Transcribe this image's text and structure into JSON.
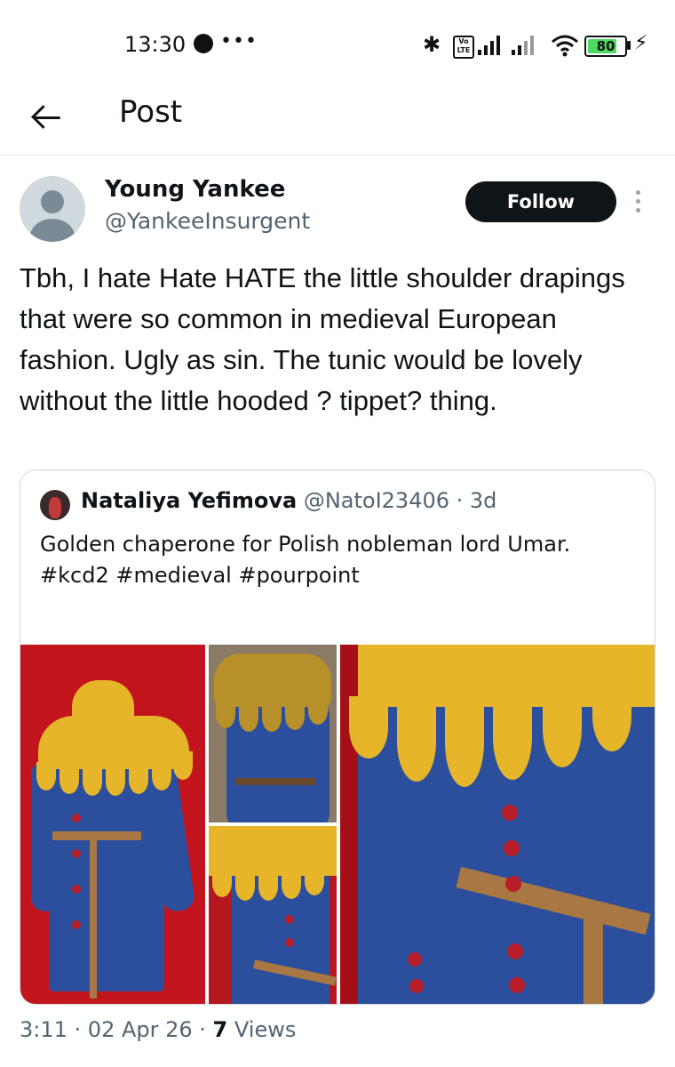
{
  "status_bar": {
    "time": "13:30",
    "dots": "•••",
    "volte": "Vo LTE",
    "battery": "80",
    "colors": {
      "battery_fill": "#4cd964"
    }
  },
  "header": {
    "back_icon": "arrow-left-icon",
    "title": "Post"
  },
  "author": {
    "name": "Young Yankee",
    "handle": "@YankeeInsurgent",
    "follow_label": "Follow"
  },
  "post": {
    "text": "Tbh, I hate Hate HATE the little shoulder drapings that were so common in medieval European fashion. Ugly as sin. The tunic would be lovely without the little hooded ? tippet? thing."
  },
  "quoted": {
    "name": "Nataliya Yefimova",
    "handle": "@NatoI23406",
    "separator": " · ",
    "age": "3d",
    "text": "Golden chaperone for Polish nobleman lord Umar.\n#kcd2 #medieval #pourpoint"
  },
  "meta": {
    "time": "3:11",
    "sep": " · ",
    "date": "02 Apr 26",
    "views_count": "7",
    "views_label": " Views"
  },
  "colors": {
    "text": "#0f1419",
    "secondary": "#536471",
    "follow_bg": "#0f1419",
    "border": "#cfd9de"
  }
}
